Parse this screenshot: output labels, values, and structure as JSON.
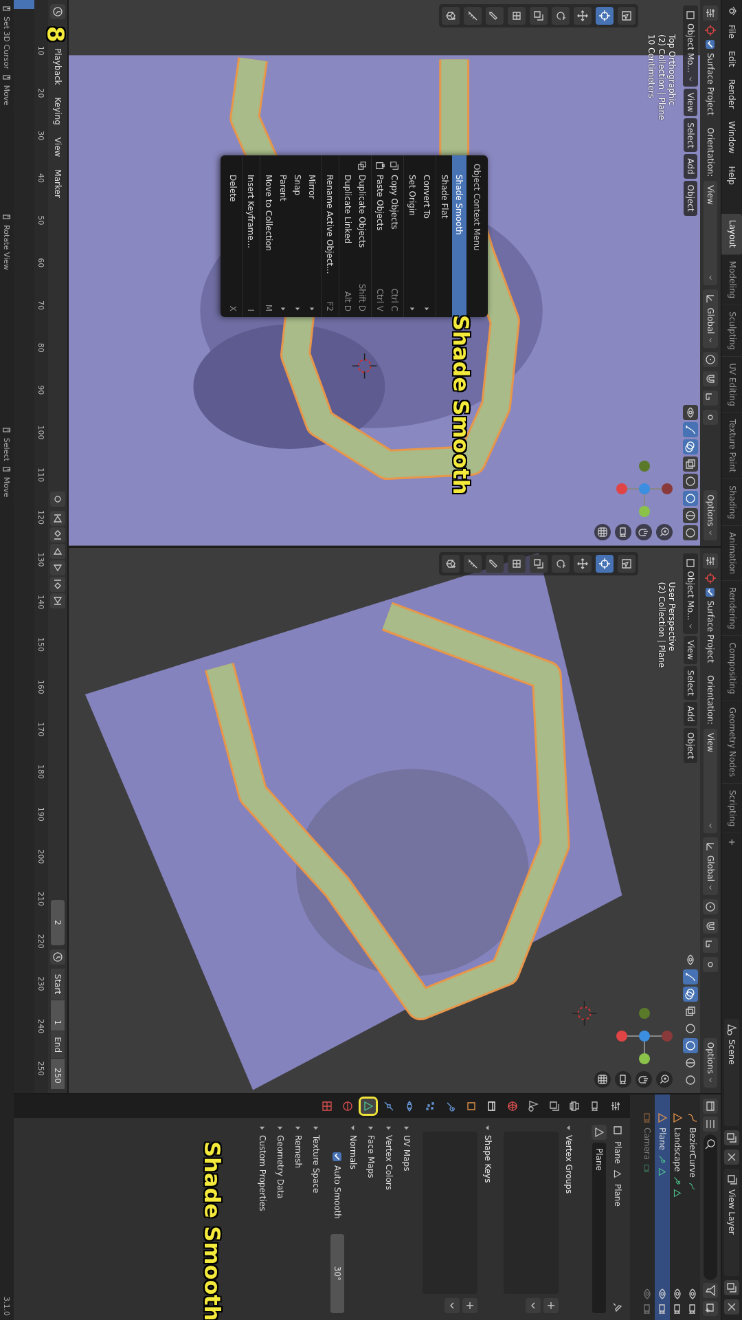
{
  "menubar": {
    "menus": [
      "File",
      "Edit",
      "Render",
      "Window",
      "Help"
    ],
    "workspaces": [
      {
        "label": "Layout",
        "selected": true
      },
      {
        "label": "Modeling",
        "selected": false
      },
      {
        "label": "Sculpting",
        "selected": false
      },
      {
        "label": "UV Editing",
        "selected": false
      },
      {
        "label": "Texture Paint",
        "selected": false
      },
      {
        "label": "Shading",
        "selected": false
      },
      {
        "label": "Animation",
        "selected": false
      },
      {
        "label": "Rendering",
        "selected": false
      },
      {
        "label": "Compositing",
        "selected": false
      },
      {
        "label": "Geometry Nodes",
        "selected": false
      },
      {
        "label": "Scripting",
        "selected": false
      }
    ],
    "add_workspace": "+",
    "scene": "Scene",
    "view_layer": "View Layer"
  },
  "viewports": [
    {
      "kind": "top",
      "tool_settings": {
        "surface_project": {
          "label": "Surface Project",
          "checked": true
        },
        "orientation_label": "Orientation:",
        "orientation": "View",
        "transform": "Global",
        "options": "Options",
        "snap_on": false,
        "proportional_on": false
      },
      "header": {
        "mode": "Object Mo...",
        "menus": [
          "View",
          "Select",
          "Add",
          "Object"
        ],
        "gizmos_on": true,
        "overlays_on": true
      },
      "shading_modes": [
        {
          "selected": false
        },
        {
          "selected": true
        },
        {
          "selected": false
        },
        {
          "selected": false
        }
      ],
      "info": [
        "Top Orthographic",
        "(2) Collection | Plane",
        "10 Centimeters"
      ]
    },
    {
      "kind": "perspective",
      "tool_settings": {
        "surface_project": {
          "label": "Surface Project",
          "checked": true
        },
        "orientation_label": "Orientation:",
        "orientation": "View",
        "transform": "Global",
        "options": "Options",
        "snap_on": false,
        "proportional_on": false
      },
      "header": {
        "mode": "Object Mo...",
        "menus": [
          "View",
          "Select",
          "Add",
          "Object"
        ],
        "gizmos_on": true,
        "overlays_on": true
      },
      "shading_modes": [
        {
          "selected": false
        },
        {
          "selected": true
        },
        {
          "selected": false
        },
        {
          "selected": false
        }
      ],
      "info": [
        "User Perspective",
        "(2) Collection | Plane"
      ]
    }
  ],
  "context_menu": {
    "title": "Object Context Menu",
    "groups": [
      [
        {
          "label": "Shade Smooth",
          "kind": "plain",
          "selected": true
        },
        {
          "label": "Shade Flat",
          "kind": "plain",
          "selected": false
        }
      ],
      [
        {
          "label": "Convert To",
          "kind": "submenu",
          "selected": false
        },
        {
          "label": "Set Origin",
          "kind": "submenu",
          "selected": false
        }
      ],
      [
        {
          "label": "Copy Objects",
          "kind": "copy",
          "shortcut": "Ctrl C",
          "selected": false
        },
        {
          "label": "Paste Objects",
          "kind": "paste",
          "shortcut": "Ctrl V",
          "selected": false
        }
      ],
      [
        {
          "label": "Duplicate Objects",
          "kind": "duplicate",
          "shortcut": "Shift D",
          "selected": false
        },
        {
          "label": "Duplicate Linked",
          "kind": "plain",
          "shortcut": "Alt D",
          "selected": false
        }
      ],
      [
        {
          "label": "Rename Active Object...",
          "kind": "plain",
          "shortcut": "F2",
          "selected": false
        }
      ],
      [
        {
          "label": "Mirror",
          "kind": "submenu",
          "selected": false
        },
        {
          "label": "Snap",
          "kind": "submenu",
          "selected": false
        },
        {
          "label": "Parent",
          "kind": "submenu",
          "selected": false
        },
        {
          "label": "Move to Collection",
          "kind": "plain",
          "shortcut": "M",
          "selected": false
        }
      ],
      [
        {
          "label": "Insert Keyframe...",
          "kind": "plain",
          "shortcut": "I",
          "selected": false
        }
      ],
      [
        {
          "label": "Delete",
          "kind": "plain",
          "shortcut": "X",
          "selected": false
        }
      ]
    ]
  },
  "outliner": {
    "rows": [
      {
        "name": "BezierCurve",
        "kind": "curve",
        "selected": false,
        "disabled": false
      },
      {
        "name": "Landscape",
        "kind": "mesh",
        "selected": false,
        "disabled": false
      },
      {
        "name": "Plane",
        "kind": "mesh",
        "selected": true,
        "disabled": false
      },
      {
        "name": "Camera",
        "kind": "camera",
        "selected": false,
        "disabled": true
      }
    ]
  },
  "properties": {
    "tabs": [
      {
        "selected": false
      },
      {
        "selected": false
      },
      {
        "selected": false
      },
      {
        "selected": false
      },
      {
        "selected": false
      },
      {
        "selected": false
      },
      {
        "selected": false
      },
      {
        "selected": false
      },
      {
        "selected": false
      },
      {
        "selected": false
      },
      {
        "selected": false
      },
      {
        "selected": false
      },
      {
        "selected": true
      },
      {
        "selected": false
      },
      {
        "selected": false
      }
    ],
    "breadcrumb": [
      "Plane",
      "Plane"
    ],
    "mesh_name": "Plane",
    "panels": [
      {
        "title": "Vertex Groups",
        "kind": "list",
        "expanded": true
      },
      {
        "title": "Shape Keys",
        "kind": "list",
        "expanded": true
      },
      {
        "title": "UV Maps",
        "kind": "plain",
        "expanded": false
      },
      {
        "title": "Vertex Colors",
        "kind": "plain",
        "expanded": false
      },
      {
        "title": "Face Maps",
        "kind": "plain",
        "expanded": false
      },
      {
        "title": "Normals",
        "kind": "normals",
        "expanded": true,
        "auto_smooth": {
          "label": "Auto Smooth",
          "checked": true,
          "angle": "30°"
        }
      },
      {
        "title": "Texture Space",
        "kind": "plain",
        "expanded": false
      },
      {
        "title": "Remesh",
        "kind": "plain",
        "expanded": false
      },
      {
        "title": "Geometry Data",
        "kind": "plain",
        "expanded": false
      },
      {
        "title": "Custom Properties",
        "kind": "plain",
        "expanded": false
      }
    ]
  },
  "timeline": {
    "menus": [
      "Playback",
      "Keying",
      "View",
      "Marker"
    ],
    "current_frame": "2",
    "start": {
      "label": "Start",
      "value": "1"
    },
    "end": {
      "label": "End",
      "value": "250"
    },
    "frame_numbers": [
      "10",
      "20",
      "30",
      "40",
      "50",
      "60",
      "70",
      "80",
      "90",
      "100",
      "110",
      "120",
      "130",
      "140",
      "150",
      "160",
      "170",
      "180",
      "190",
      "200",
      "210",
      "220",
      "230",
      "240",
      "250"
    ],
    "playhead": {
      "level": 0.008
    }
  },
  "status_bar": {
    "groups": [
      [
        "Set 3D Cursor",
        "Move"
      ],
      [
        "Rotate View"
      ],
      [
        "Select",
        "Move"
      ]
    ],
    "version": "3.1.0"
  },
  "annotations": [
    {
      "text": "Shade Smooth",
      "kind": "callout"
    },
    {
      "text": "Shade Smooth",
      "kind": "callout"
    },
    {
      "text": "8",
      "kind": "step"
    }
  ]
}
